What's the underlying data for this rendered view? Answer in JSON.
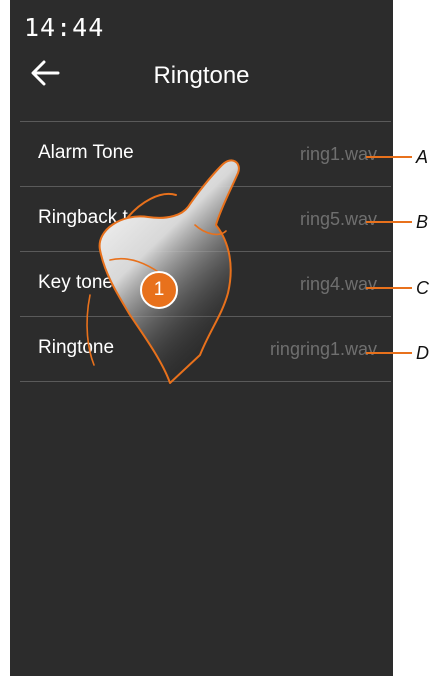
{
  "status": {
    "time": "14:44"
  },
  "header": {
    "title": "Ringtone"
  },
  "list": {
    "items": [
      {
        "label": "Alarm Tone",
        "value": "ring1.wav",
        "callout": "A"
      },
      {
        "label": "Ringback t",
        "value": "ring5.wav",
        "callout": "B"
      },
      {
        "label": "Key tone",
        "value": "ring4.wav",
        "callout": "C"
      },
      {
        "label": "Ringtone",
        "value": "ringring1.wav",
        "callout": "D"
      }
    ]
  },
  "step_badge": "1",
  "icons": {
    "back": "arrow-left-icon",
    "gesture": "tap-hand-icon"
  },
  "colors": {
    "screen_bg": "#2c2c2c",
    "accent": "#e8711c",
    "value_text": "#6f6f6f"
  }
}
